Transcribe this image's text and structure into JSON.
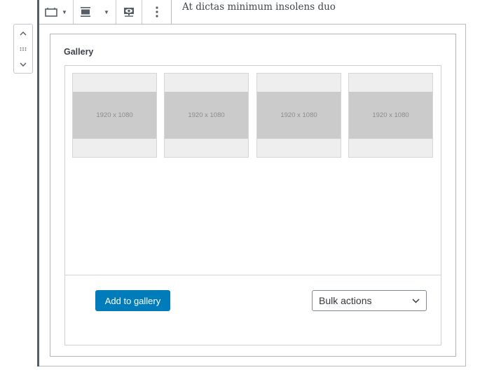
{
  "toolbar": {
    "buttons": [
      {
        "name": "block-type",
        "icon": "gallery-icon",
        "has_dropdown": true
      },
      {
        "name": "alignment",
        "icon": "align-center-icon",
        "has_dropdown": true
      },
      {
        "name": "preview",
        "icon": "preview-eye-icon",
        "has_dropdown": false
      },
      {
        "name": "more-options",
        "icon": "more-vertical-icon",
        "has_dropdown": false
      }
    ]
  },
  "mover": {
    "up_icon": "chevron-up-icon",
    "drag_icon": "drag-handle-icon",
    "down_icon": "chevron-down-icon"
  },
  "paragraph_text": "At dictas minimum insolens duo",
  "gallery": {
    "title": "Gallery",
    "images": [
      {
        "label": "1920 x 1080"
      },
      {
        "label": "1920 x 1080"
      },
      {
        "label": "1920 x 1080"
      },
      {
        "label": "1920 x 1080"
      }
    ],
    "add_button_label": "Add to gallery",
    "bulk_actions": {
      "selected": "Bulk actions"
    }
  },
  "colors": {
    "primary": "#007cba",
    "rail": "#555d66"
  }
}
